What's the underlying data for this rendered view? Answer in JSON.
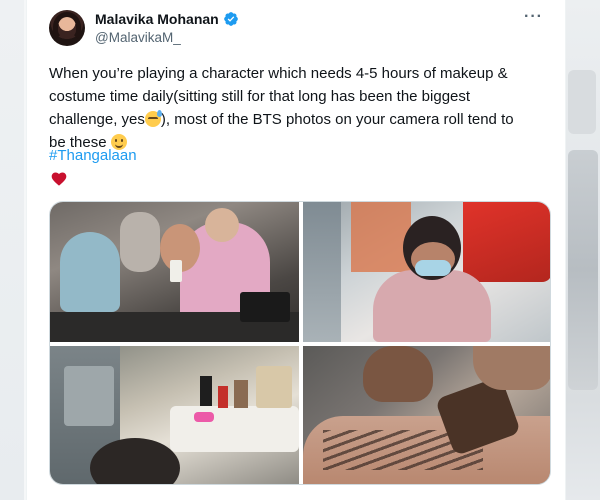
{
  "tweet": {
    "author": {
      "display_name": "Malavika Mohanan",
      "handle": "@MalavikaM_",
      "verified": true
    },
    "text_lines": [
      "When you’re playing a character which needs 4-5 hours of makeup &",
      "costume time daily(sitting still for that long has been the biggest",
      "challenge, yes",
      "), most of the BTS photos on your camera roll tend to",
      "be these"
    ],
    "hashtag": "#Thangalaan",
    "heart_emoji": "heart-icon",
    "media": {
      "count": 4,
      "photos": [
        {
          "name": "makeup-room-photo"
        },
        {
          "name": "girl-in-pink-photo"
        },
        {
          "name": "vanity-table-photo"
        },
        {
          "name": "body-paint-photo"
        }
      ]
    },
    "more_icon": "more-options-icon"
  },
  "colors": {
    "link": "#1d9bf0",
    "text": "#0f1419",
    "secondary": "#536471",
    "heart": "#c8102e"
  }
}
